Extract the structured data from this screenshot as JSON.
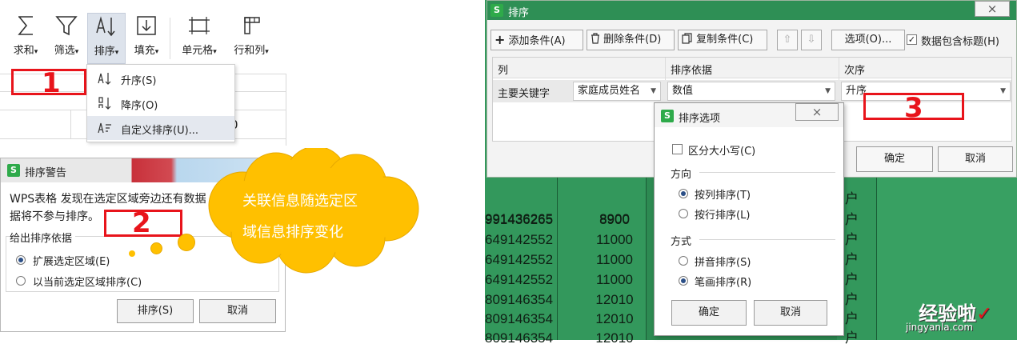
{
  "toolbar": {
    "buttons": [
      {
        "label": "求和",
        "icon": "sigma-icon",
        "caret": "▾"
      },
      {
        "label": "筛选",
        "icon": "filter-funnel-icon",
        "caret": "▾"
      },
      {
        "label": "排序",
        "icon": "sort-icon",
        "caret": "▾"
      },
      {
        "label": "填充",
        "icon": "fill-down-icon",
        "caret": "▾"
      },
      {
        "label": "单元格",
        "icon": "cell-icon",
        "caret": "▾"
      },
      {
        "label": "行和列",
        "icon": "row-column-icon",
        "caret": "▾"
      }
    ],
    "grid_value": "0"
  },
  "sort_menu": {
    "items": [
      {
        "label": "升序(S)",
        "icon": "sort-ascending-icon"
      },
      {
        "label": "降序(O)",
        "icon": "sort-descending-icon"
      },
      {
        "label": "自定义排序(U)...",
        "icon": "custom-sort-icon"
      }
    ]
  },
  "markers": {
    "one": "1",
    "two": "2",
    "three": "3"
  },
  "warning_dialog": {
    "logo": "S",
    "title": "排序警告",
    "close": "×",
    "message_line1": "WPS表格 发现在选定区域旁边还有数据",
    "message_line2": "据将不参与排序。",
    "group_label": "给出排序依据",
    "option_expand": "扩展选定区域(E)",
    "option_current": "以当前选定区域排序(C)",
    "sort_button": "排序(S)",
    "cancel_button": "取消"
  },
  "callout": {
    "line1": "关联信息随选定区",
    "line2": "域信息排序变化"
  },
  "sheet": {
    "rows": [
      {
        "a": "991436265",
        "b": "8900",
        "c": "户"
      },
      {
        "a": "991436265",
        "b": "8900",
        "c": "户"
      },
      {
        "a": "649142552",
        "b": "11000",
        "c": "户"
      },
      {
        "a": "649142552",
        "b": "11000",
        "c": "户"
      },
      {
        "a": "649142552",
        "b": "11000",
        "c": "户"
      },
      {
        "a": "809146354",
        "b": "12010",
        "c": "户"
      },
      {
        "a": "809146354",
        "b": "12010",
        "c": "户"
      },
      {
        "a": "809146354",
        "b": "12010",
        "c": "户"
      }
    ]
  },
  "sort_dialog": {
    "logo": "S",
    "title": "排序",
    "close": "×",
    "add_condition": "添加条件(A)",
    "delete_condition": "删除条件(D)",
    "copy_condition": "复制条件(C)",
    "options_button": "选项(O)...",
    "header_checkbox": "数据包含标题(H)",
    "col_header": "列",
    "basis_header": "排序依据",
    "order_header": "次序",
    "key_label": "主要关键字",
    "key_value": "家庭成员姓名",
    "basis_value": "数值",
    "order_value": "升序",
    "ok_button": "确定",
    "cancel_button": "取消"
  },
  "options_dialog": {
    "logo": "S",
    "title": "排序选项",
    "close": "×",
    "case_checkbox": "区分大小写(C)",
    "direction_label": "方向",
    "by_column": "按列排序(T)",
    "by_row": "按行排序(L)",
    "method_label": "方式",
    "pinyin": "拼音排序(S)",
    "stroke": "笔画排序(R)",
    "ok_button": "确定",
    "cancel_button": "取消"
  },
  "watermark": {
    "text": "经验啦",
    "check": "✓",
    "url": "jingyanla.com"
  },
  "colors": {
    "accent_red": "#e8141b",
    "sheet_green": "#2d8a52",
    "cloud_yellow": "#ffc000",
    "wps_green": "#2eaa4a"
  }
}
